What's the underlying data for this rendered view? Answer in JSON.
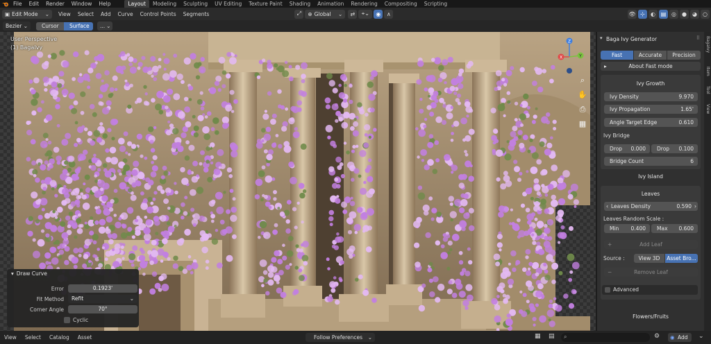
{
  "topbar": {
    "menus": [
      "File",
      "Edit",
      "Render",
      "Window",
      "Help"
    ],
    "workspaces": [
      "Layout",
      "Modeling",
      "Sculpting",
      "UV Editing",
      "Texture Paint",
      "Shading",
      "Animation",
      "Rendering",
      "Compositing",
      "Scripting"
    ],
    "active_workspace": "Layout"
  },
  "header": {
    "mode": "Edit Mode",
    "menus": [
      "View",
      "Select",
      "Add",
      "Curve",
      "Control Points",
      "Segments"
    ],
    "transform_orientation": "Global"
  },
  "toolrow": {
    "curve_type": "Bezier",
    "depth_options": [
      "Cursor",
      "Surface"
    ],
    "active_depth": "Surface",
    "more": "..."
  },
  "viewport": {
    "perspective": "User Perspective",
    "object": "(1) BagaIvy",
    "gizmo": {
      "x": "X",
      "y": "Y",
      "z": "Z"
    },
    "icons": [
      "zoom-icon",
      "hand-icon",
      "camera-icon",
      "grid-icon"
    ]
  },
  "draw_curve": {
    "title": "Draw Curve",
    "rows": [
      {
        "label": "Error",
        "value": "0.1923'"
      },
      {
        "label": "Fit Method",
        "value": "Refit"
      },
      {
        "label": "Corner Angle",
        "value": "70°"
      }
    ],
    "cyclic_label": "Cyclic"
  },
  "panel": {
    "title": "Baga Ivy Generator",
    "modes": [
      "Fast",
      "Accurate",
      "Precision"
    ],
    "active_mode": "Fast",
    "about": "About Fast mode",
    "ivy_growth": {
      "title": "Ivy Growth",
      "fields": [
        {
          "label": "Ivy Density",
          "value": "9.970"
        },
        {
          "label": "Ivy Propagation",
          "value": "1.65'"
        },
        {
          "label": "Angle Target Edge",
          "value": "0.610"
        }
      ],
      "bridge_label": "Ivy Bridge",
      "drop1": {
        "label": "Drop",
        "value": "0.000"
      },
      "drop2": {
        "label": "Drop",
        "value": "0.100"
      },
      "bridge_count": {
        "label": "Bridge Count",
        "value": "6"
      }
    },
    "ivy_island": "Ivy Island",
    "leaves": {
      "title": "Leaves",
      "density": {
        "label": "Leaves Density",
        "value": "0.590"
      },
      "random_scale_label": "Leaves Random Scale :",
      "min": {
        "label": "Min",
        "value": "0.400"
      },
      "max": {
        "label": "Max",
        "value": "0.600"
      },
      "add_leaf": "Add Leaf",
      "source_label": "Source :",
      "source_options": [
        "View 3D",
        "Asset Bro..."
      ],
      "active_source": "Asset Bro...",
      "remove_leaf": "Remove Leaf",
      "advanced": "Advanced"
    },
    "flowers": "Flowers/Fruits"
  },
  "sidetabs": [
    "BagaIvy",
    "Item",
    "Tool",
    "View"
  ],
  "bottombar": {
    "menus": [
      "View",
      "Select",
      "Catalog",
      "Asset"
    ],
    "follow": "Follow Preferences",
    "add": "Add"
  },
  "colors": {
    "accent": "#4772b3",
    "flower": "#c27fe0",
    "flower_light": "#e3b9f2",
    "stone": "#cdb898"
  }
}
